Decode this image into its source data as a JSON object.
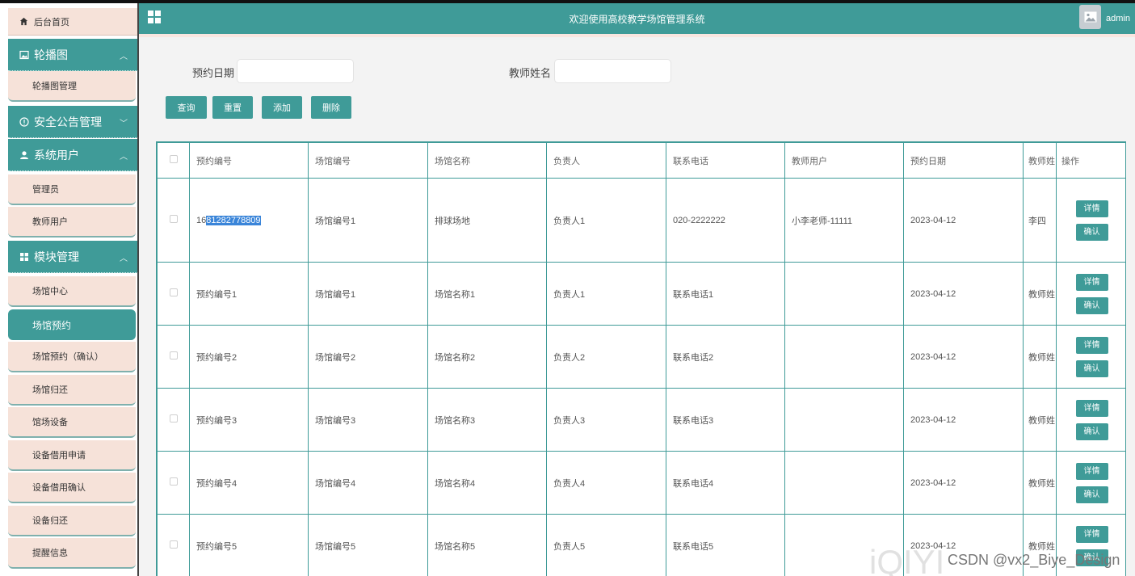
{
  "sidebar": {
    "home": "后台首页",
    "groups": [
      {
        "label": "轮播图",
        "items": [
          "轮播图管理"
        ]
      },
      {
        "label": "安全公告管理",
        "items": []
      },
      {
        "label": "系统用户",
        "items": [
          "管理员",
          "教师用户"
        ]
      },
      {
        "label": "模块管理",
        "items": [
          "场馆中心",
          "场馆预约",
          "场馆预约（确认）",
          "场馆归还",
          "馆场设备",
          "设备借用申请",
          "设备借用确认",
          "设备归还",
          "提醒信息"
        ]
      }
    ],
    "active_item": "场馆预约"
  },
  "header": {
    "title": "欢迎使用高校教学场馆管理系统",
    "user": "admin"
  },
  "search": {
    "date_label": "预约日期",
    "date_value": "",
    "teacher_label": "教师姓名",
    "teacher_value": ""
  },
  "toolbar": {
    "query": "查询",
    "reset": "重置",
    "add": "添加",
    "delete": "删除"
  },
  "table": {
    "columns": [
      "预约编号",
      "场馆编号",
      "场馆名称",
      "负责人",
      "联系电话",
      "教师用户",
      "预约日期",
      "教师姓",
      "操作"
    ],
    "rows": [
      {
        "id_pre": "16",
        "id_sel": "81282778809",
        "venue_no": "场馆编号1",
        "venue_name": "排球场地",
        "manager": "负责人1",
        "phone": "020-2222222",
        "teacher_user": "小李老师-11111",
        "date": "2023-04-12",
        "teacher_name": "李四"
      },
      {
        "id_pre": "预约编号1",
        "id_sel": "",
        "venue_no": "场馆编号1",
        "venue_name": "场馆名称1",
        "manager": "负责人1",
        "phone": "联系电话1",
        "teacher_user": "",
        "date": "2023-04-12",
        "teacher_name": "教师姓"
      },
      {
        "id_pre": "预约编号2",
        "id_sel": "",
        "venue_no": "场馆编号2",
        "venue_name": "场馆名称2",
        "manager": "负责人2",
        "phone": "联系电话2",
        "teacher_user": "",
        "date": "2023-04-12",
        "teacher_name": "教师姓"
      },
      {
        "id_pre": "预约编号3",
        "id_sel": "",
        "venue_no": "场馆编号3",
        "venue_name": "场馆名称3",
        "manager": "负责人3",
        "phone": "联系电话3",
        "teacher_user": "",
        "date": "2023-04-12",
        "teacher_name": "教师姓"
      },
      {
        "id_pre": "预约编号4",
        "id_sel": "",
        "venue_no": "场馆编号4",
        "venue_name": "场馆名称4",
        "manager": "负责人4",
        "phone": "联系电话4",
        "teacher_user": "",
        "date": "2023-04-12",
        "teacher_name": "教师姓"
      },
      {
        "id_pre": "预约编号5",
        "id_sel": "",
        "venue_no": "场馆编号5",
        "venue_name": "场馆名称5",
        "manager": "负责人5",
        "phone": "联系电话5",
        "teacher_user": "",
        "date": "2023-04-12",
        "teacher_name": "教师姓"
      }
    ],
    "detail_label": "详情",
    "confirm_label": "确认"
  },
  "watermark": {
    "logo": "iQIYI",
    "credit": "CSDN @vx2_Biye_Design"
  },
  "colors": {
    "primary": "#3f9b98",
    "sidebar_item_bg": "#f6e2d9",
    "selection": "#3a85d9"
  },
  "icons": [
    "home-icon",
    "image-icon",
    "info-icon",
    "user-icon",
    "grid-icon",
    "menu-grid-icon",
    "avatar-image-icon",
    "chevron-up-icon",
    "chevron-down-icon"
  ]
}
